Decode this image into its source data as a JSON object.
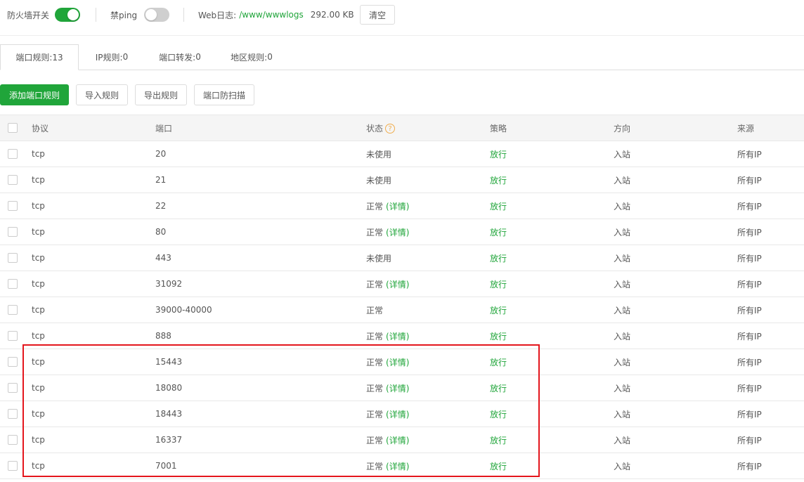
{
  "topbar": {
    "firewall_label": "防火墙开关",
    "firewall_on": true,
    "ping_label": "禁ping",
    "ping_on": false,
    "weblog_label": "Web日志:",
    "weblog_path": "/www/wwwlogs",
    "weblog_size": "292.00 KB",
    "clear_label": "清空"
  },
  "tabs": [
    {
      "label": "端口规则:",
      "count": "13",
      "active": true
    },
    {
      "label": "IP规则:",
      "count": "0",
      "active": false
    },
    {
      "label": "端口转发:",
      "count": "0",
      "active": false
    },
    {
      "label": "地区规则:",
      "count": "0",
      "active": false
    }
  ],
  "actions": {
    "add": "添加端口规则",
    "import": "导入规则",
    "export": "导出规则",
    "antiscan": "端口防扫描"
  },
  "table": {
    "headers": {
      "protocol": "协议",
      "port": "端口",
      "status": "状态",
      "policy": "策略",
      "direction": "方向",
      "source": "来源"
    },
    "help_glyph": "?",
    "rows": [
      {
        "protocol": "tcp",
        "port": "20",
        "status": "未使用",
        "detail": "",
        "policy": "放行",
        "direction": "入站",
        "source": "所有IP"
      },
      {
        "protocol": "tcp",
        "port": "21",
        "status": "未使用",
        "detail": "",
        "policy": "放行",
        "direction": "入站",
        "source": "所有IP"
      },
      {
        "protocol": "tcp",
        "port": "22",
        "status": "正常",
        "detail": "(详情)",
        "policy": "放行",
        "direction": "入站",
        "source": "所有IP"
      },
      {
        "protocol": "tcp",
        "port": "80",
        "status": "正常",
        "detail": "(详情)",
        "policy": "放行",
        "direction": "入站",
        "source": "所有IP"
      },
      {
        "protocol": "tcp",
        "port": "443",
        "status": "未使用",
        "detail": "",
        "policy": "放行",
        "direction": "入站",
        "source": "所有IP"
      },
      {
        "protocol": "tcp",
        "port": "31092",
        "status": "正常",
        "detail": "(详情)",
        "policy": "放行",
        "direction": "入站",
        "source": "所有IP"
      },
      {
        "protocol": "tcp",
        "port": "39000-40000",
        "status": "正常",
        "detail": "",
        "policy": "放行",
        "direction": "入站",
        "source": "所有IP"
      },
      {
        "protocol": "tcp",
        "port": "888",
        "status": "正常",
        "detail": "(详情)",
        "policy": "放行",
        "direction": "入站",
        "source": "所有IP"
      },
      {
        "protocol": "tcp",
        "port": "15443",
        "status": "正常",
        "detail": "(详情)",
        "policy": "放行",
        "direction": "入站",
        "source": "所有IP"
      },
      {
        "protocol": "tcp",
        "port": "18080",
        "status": "正常",
        "detail": "(详情)",
        "policy": "放行",
        "direction": "入站",
        "source": "所有IP"
      },
      {
        "protocol": "tcp",
        "port": "18443",
        "status": "正常",
        "detail": "(详情)",
        "policy": "放行",
        "direction": "入站",
        "source": "所有IP"
      },
      {
        "protocol": "tcp",
        "port": "16337",
        "status": "正常",
        "detail": "(详情)",
        "policy": "放行",
        "direction": "入站",
        "source": "所有IP"
      },
      {
        "protocol": "tcp",
        "port": "7001",
        "status": "正常",
        "detail": "(详情)",
        "policy": "放行",
        "direction": "入站",
        "source": "所有IP"
      }
    ]
  },
  "colors": {
    "accent": "#20a53a",
    "highlight": "#e4161d",
    "help": "#f0ad4e"
  }
}
